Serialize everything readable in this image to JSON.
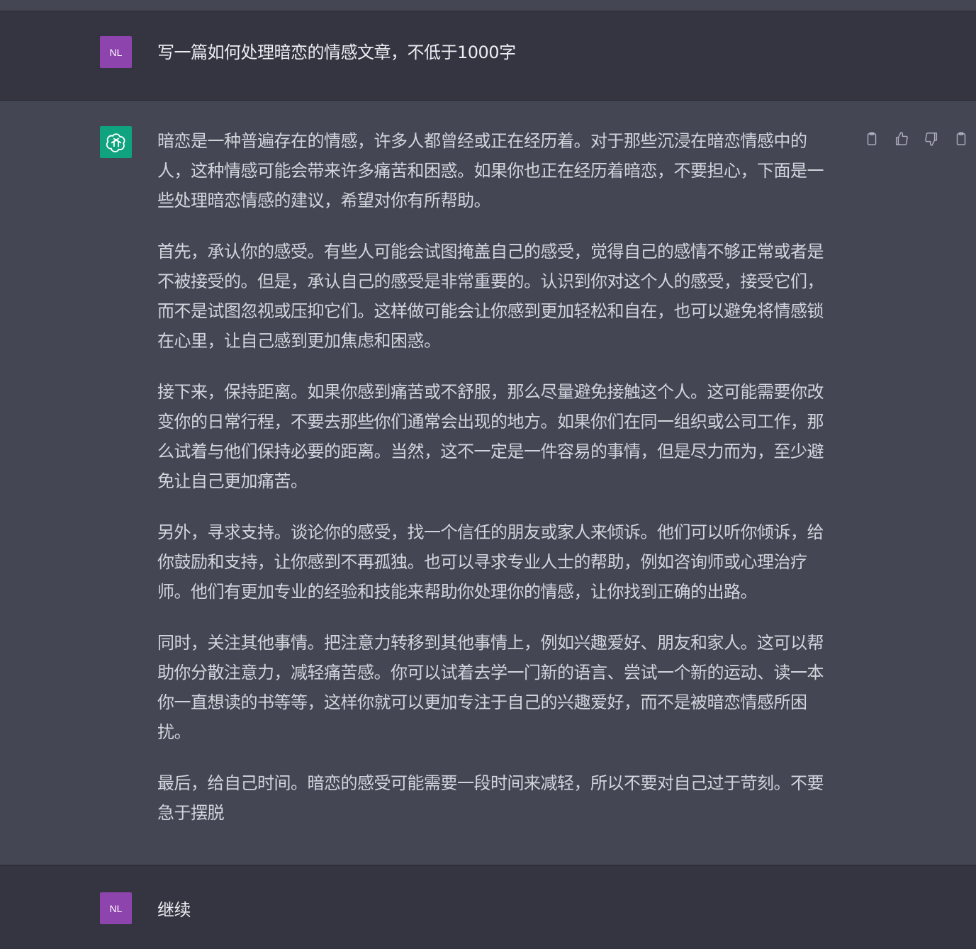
{
  "conversation": {
    "first_user": {
      "avatar": "NL",
      "text": "写一篇如何处理暗恋的情感文章，不低于1000字"
    },
    "assistant": {
      "avatar_icon": "openai-logo-icon",
      "paragraphs": [
        "暗恋是一种普遍存在的情感，许多人都曾经或正在经历着。对于那些沉浸在暗恋情感中的人，这种情感可能会带来许多痛苦和困惑。如果你也正在经历着暗恋，不要担心，下面是一些处理暗恋情感的建议，希望对你有所帮助。",
        "首先，承认你的感受。有些人可能会试图掩盖自己的感受，觉得自己的感情不够正常或者是不被接受的。但是，承认自己的感受是非常重要的。认识到你对这个人的感受，接受它们，而不是试图忽视或压抑它们。这样做可能会让你感到更加轻松和自在，也可以避免将情感锁在心里，让自己感到更加焦虑和困惑。",
        "接下来，保持距离。如果你感到痛苦或不舒服，那么尽量避免接触这个人。这可能需要你改变你的日常行程，不要去那些你们通常会出现的地方。如果你们在同一组织或公司工作，那么试着与他们保持必要的距离。当然，这不一定是一件容易的事情，但是尽力而为，至少避免让自己更加痛苦。",
        "另外，寻求支持。谈论你的感受，找一个信任的朋友或家人来倾诉。他们可以听你倾诉，给你鼓励和支持，让你感到不再孤独。也可以寻求专业人士的帮助，例如咨询师或心理治疗师。他们有更加专业的经验和技能来帮助你处理你的情感，让你找到正确的出路。",
        "同时，关注其他事情。把注意力转移到其他事情上，例如兴趣爱好、朋友和家人。这可以帮助你分散注意力，减轻痛苦感。你可以试着去学一门新的语言、尝试一个新的运动、读一本你一直想读的书等等，这样你就可以更加专注于自己的兴趣爱好，而不是被暗恋情感所困扰。",
        "最后，给自己时间。暗恋的感受可能需要一段时间来减轻，所以不要对自己过于苛刻。不要急于摆脱"
      ],
      "actions": [
        "clipboard-icon",
        "thumbs-up-icon",
        "thumbs-down-icon",
        "clipboard-icon"
      ]
    },
    "second_user": {
      "avatar": "NL",
      "text": "继续"
    }
  },
  "colors": {
    "user_bg": "#343541",
    "assistant_bg": "#444654",
    "user_avatar": "#8e44ad",
    "gpt_avatar": "#10a37f",
    "text_user": "#ececf1",
    "text_assistant": "#d1d5db"
  }
}
